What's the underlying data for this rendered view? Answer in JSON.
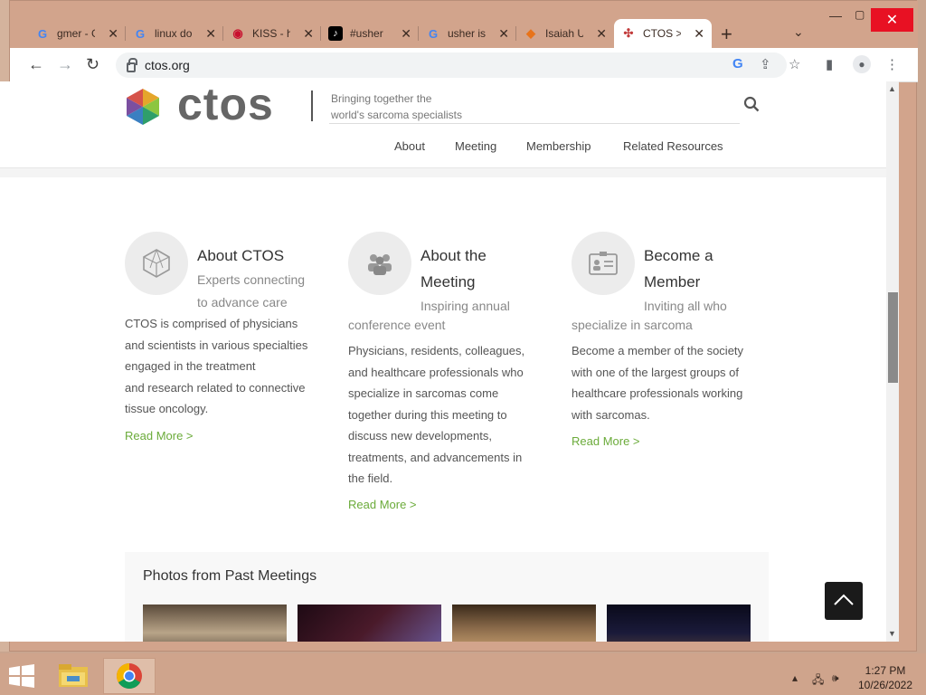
{
  "browser": {
    "tabs": [
      {
        "label": "gmer - G",
        "icon": "google-icon",
        "active": false
      },
      {
        "label": "linux do",
        "icon": "google-icon",
        "active": false
      },
      {
        "label": "KISS - h",
        "icon": "lips-icon",
        "active": false
      },
      {
        "label": "#usher",
        "icon": "tiktok-icon",
        "active": false
      },
      {
        "label": "usher is",
        "icon": "google-icon",
        "active": false
      },
      {
        "label": "Isaiah U",
        "icon": "fox-icon",
        "active": false
      },
      {
        "label": "CTOS >",
        "icon": "ctos-icon",
        "active": true
      }
    ],
    "address": "ctos.org"
  },
  "site": {
    "logo_text": "ctos",
    "tagline_line1": "Bringing together the",
    "tagline_line2": "world's sarcoma specialists",
    "nav": [
      "About",
      "Meeting",
      "Membership",
      "Related Resources"
    ]
  },
  "features": [
    {
      "title_line1": "About CTOS",
      "title_line2": "",
      "sub_line1": "Experts connecting",
      "sub_line2": "to advance care",
      "body": [
        "CTOS is comprised of physicians",
        "and scientists in various specialties",
        "engaged in the treatment",
        "and research related to connective",
        "tissue oncology."
      ],
      "read_more": "Read More >",
      "icon": "polyhedron-icon"
    },
    {
      "title_line1": "About the",
      "title_line2": "Meeting",
      "sub_line1": "Inspiring annual",
      "sub_line2": "conference event",
      "body": [
        "Physicians, residents, colleagues,",
        "and healthcare professionals who",
        "specialize in sarcomas come",
        "together during this meeting to",
        "discuss new developments,",
        "treatments, and advancements in",
        "the field."
      ],
      "read_more": "Read More >",
      "icon": "group-icon"
    },
    {
      "title_line1": "Become a",
      "title_line2": "Member",
      "sub_line1": "Inviting all who",
      "sub_line2": "specialize in sarcoma",
      "body": [
        "Become a member of the society",
        "with one of the largest groups of",
        "healthcare professionals working",
        "with sarcomas."
      ],
      "read_more": "Read More >",
      "icon": "id-card-icon"
    }
  ],
  "photos": {
    "title": "Photos from Past Meetings",
    "count": 4
  },
  "taskbar": {
    "time": "1:27 PM",
    "date": "10/26/2022"
  }
}
